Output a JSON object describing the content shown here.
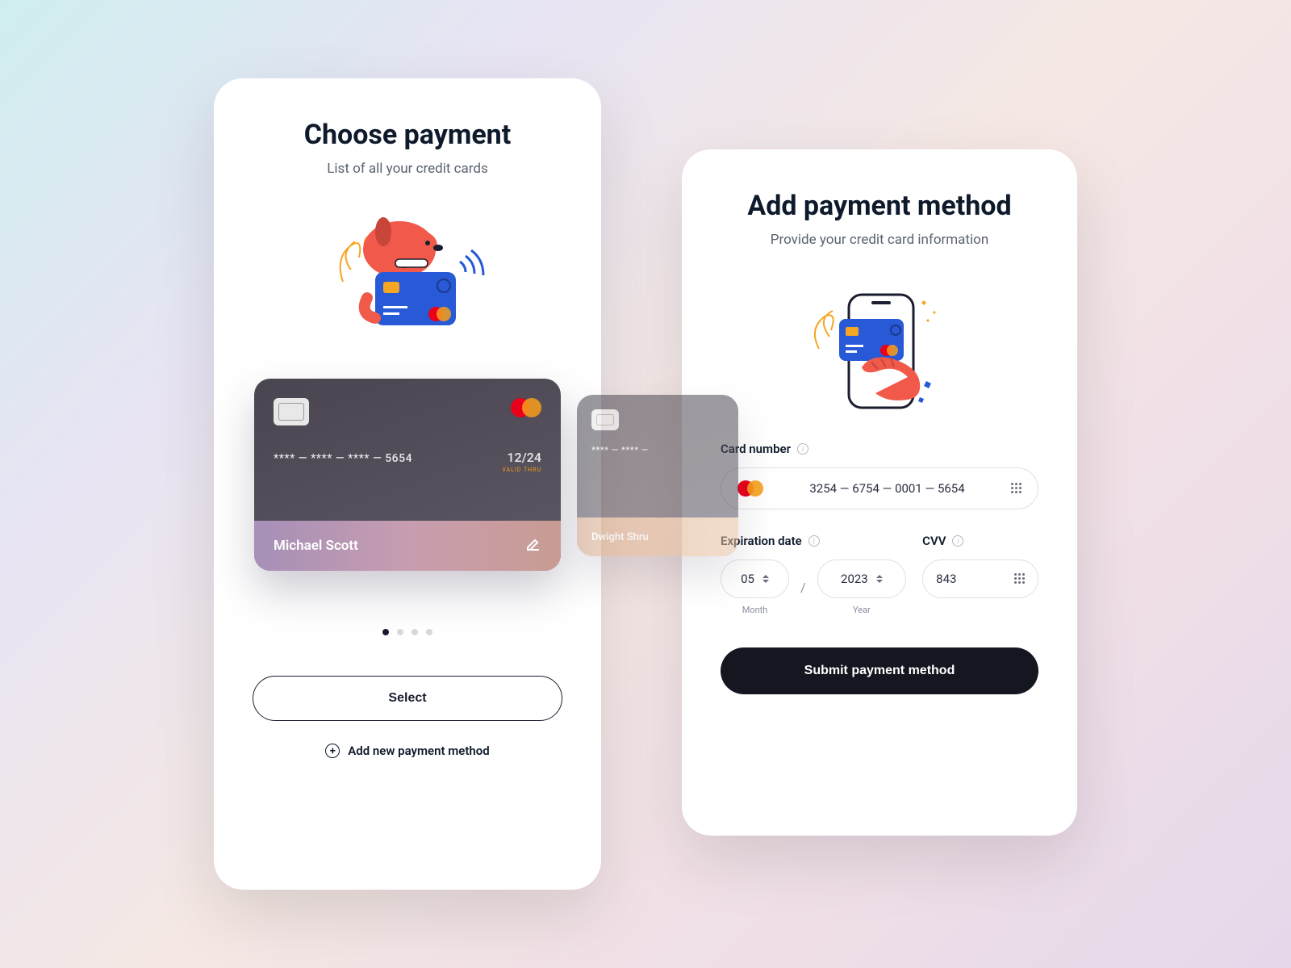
{
  "choose": {
    "title": "Choose payment",
    "subtitle": "List of all your credit cards",
    "cards": [
      {
        "number_masked": "**** — **** — **** — 5654",
        "expiry": "12/24",
        "expiry_label": "VALID THRU",
        "holder": "Michael Scott"
      },
      {
        "holder": "Dwight Shru"
      }
    ],
    "select_label": "Select",
    "add_label": "Add new payment method"
  },
  "add": {
    "title": "Add payment method",
    "subtitle": "Provide your credit card information",
    "card_number_label": "Card number",
    "card_number_value": "3254 — 6754 — 0001 — 5654",
    "expiration_label": "Expiration date",
    "month_value": "05",
    "month_label": "Month",
    "year_value": "2023",
    "year_label": "Year",
    "cvv_label": "CVV",
    "cvv_value": "843",
    "submit_label": "Submit payment method"
  }
}
